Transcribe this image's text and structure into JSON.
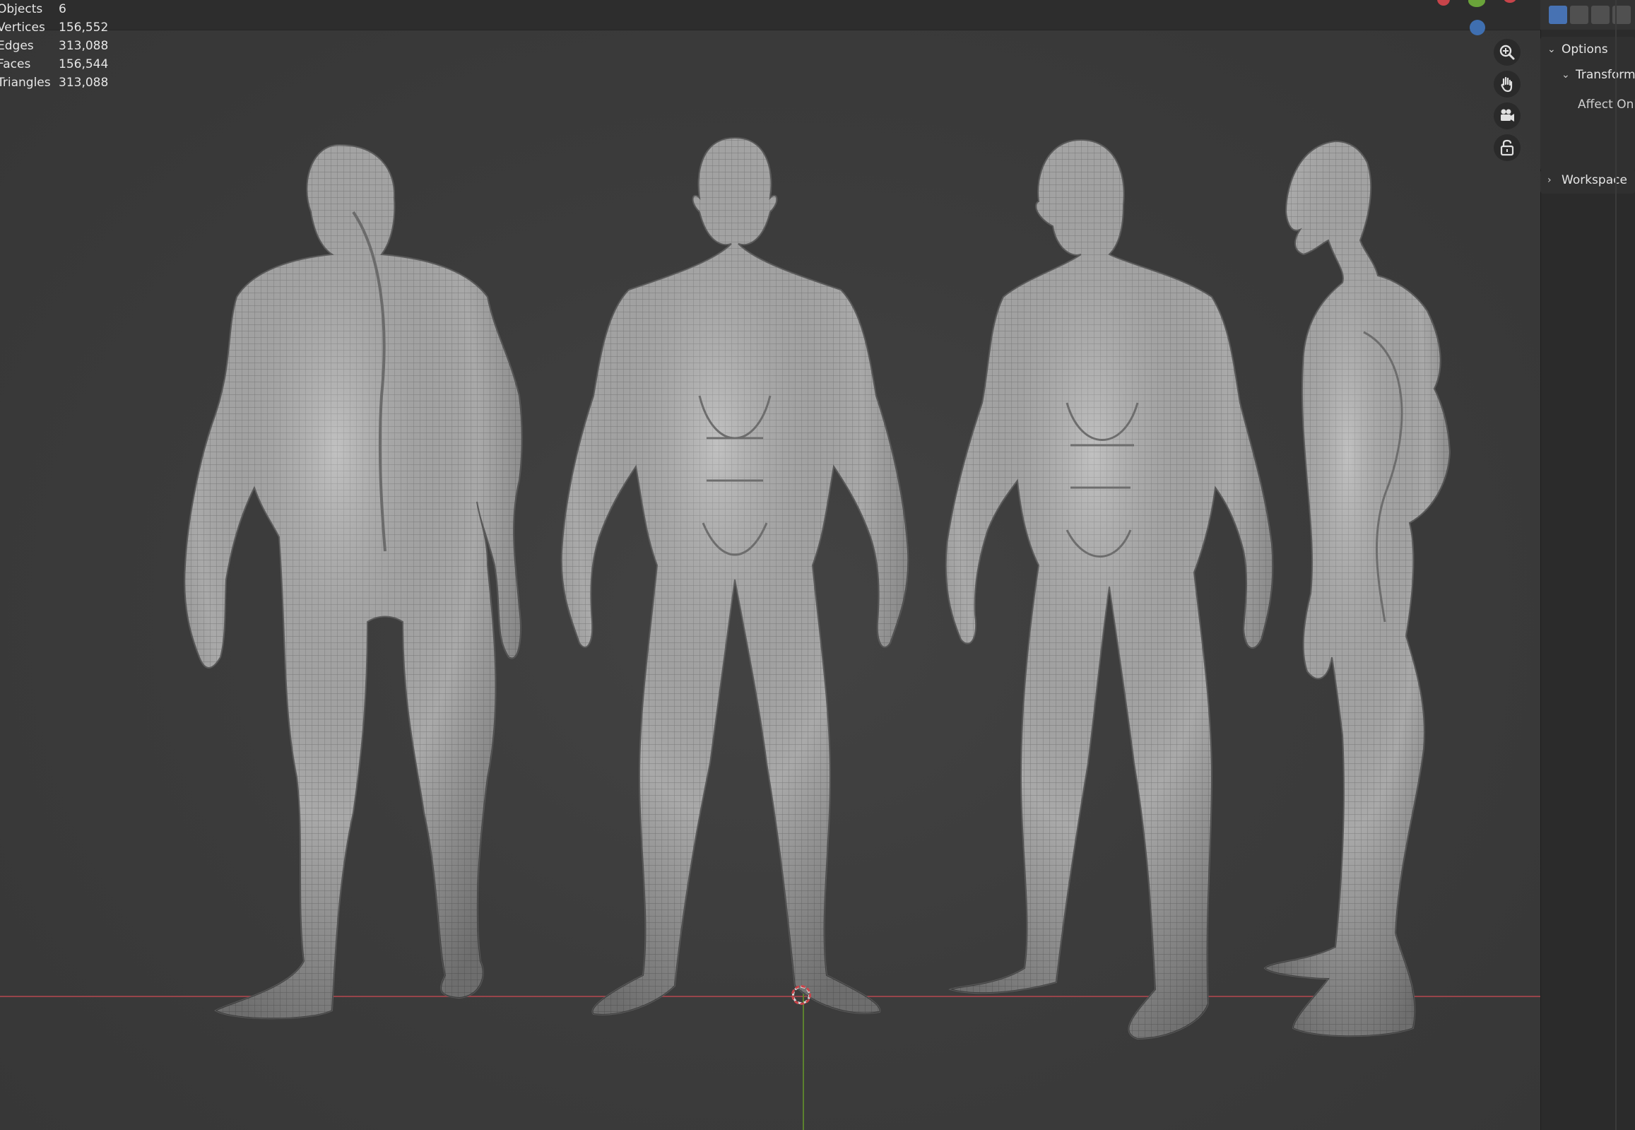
{
  "stats": [
    {
      "label": "Objects",
      "value": "6"
    },
    {
      "label": "Vertices",
      "value": "156,552"
    },
    {
      "label": "Edges",
      "value": "313,088"
    },
    {
      "label": "Faces",
      "value": "156,544"
    },
    {
      "label": "Triangles",
      "value": "313,088"
    }
  ],
  "nav_gizmo": {
    "axis_colors": {
      "x": "#c8444a",
      "y": "#6aa33a",
      "z": "#3f6fb0"
    },
    "buttons": [
      "zoom-icon",
      "hand-pan-icon",
      "camera-icon",
      "lock-icon"
    ]
  },
  "sidebar": {
    "panels": [
      {
        "label": "Options",
        "expanded": true
      },
      {
        "label": "Transform",
        "expanded": true
      },
      {
        "label": "Affect Only",
        "expanded": false
      },
      {
        "label": "Workspace",
        "expanded": false
      }
    ]
  },
  "colors": {
    "viewport_bg": "#3b3b3b",
    "x_axis": "#a8474d",
    "y_axis": "#5f8a2e",
    "mesh": "#a9a9a9",
    "active_tool": "#4772b3"
  }
}
